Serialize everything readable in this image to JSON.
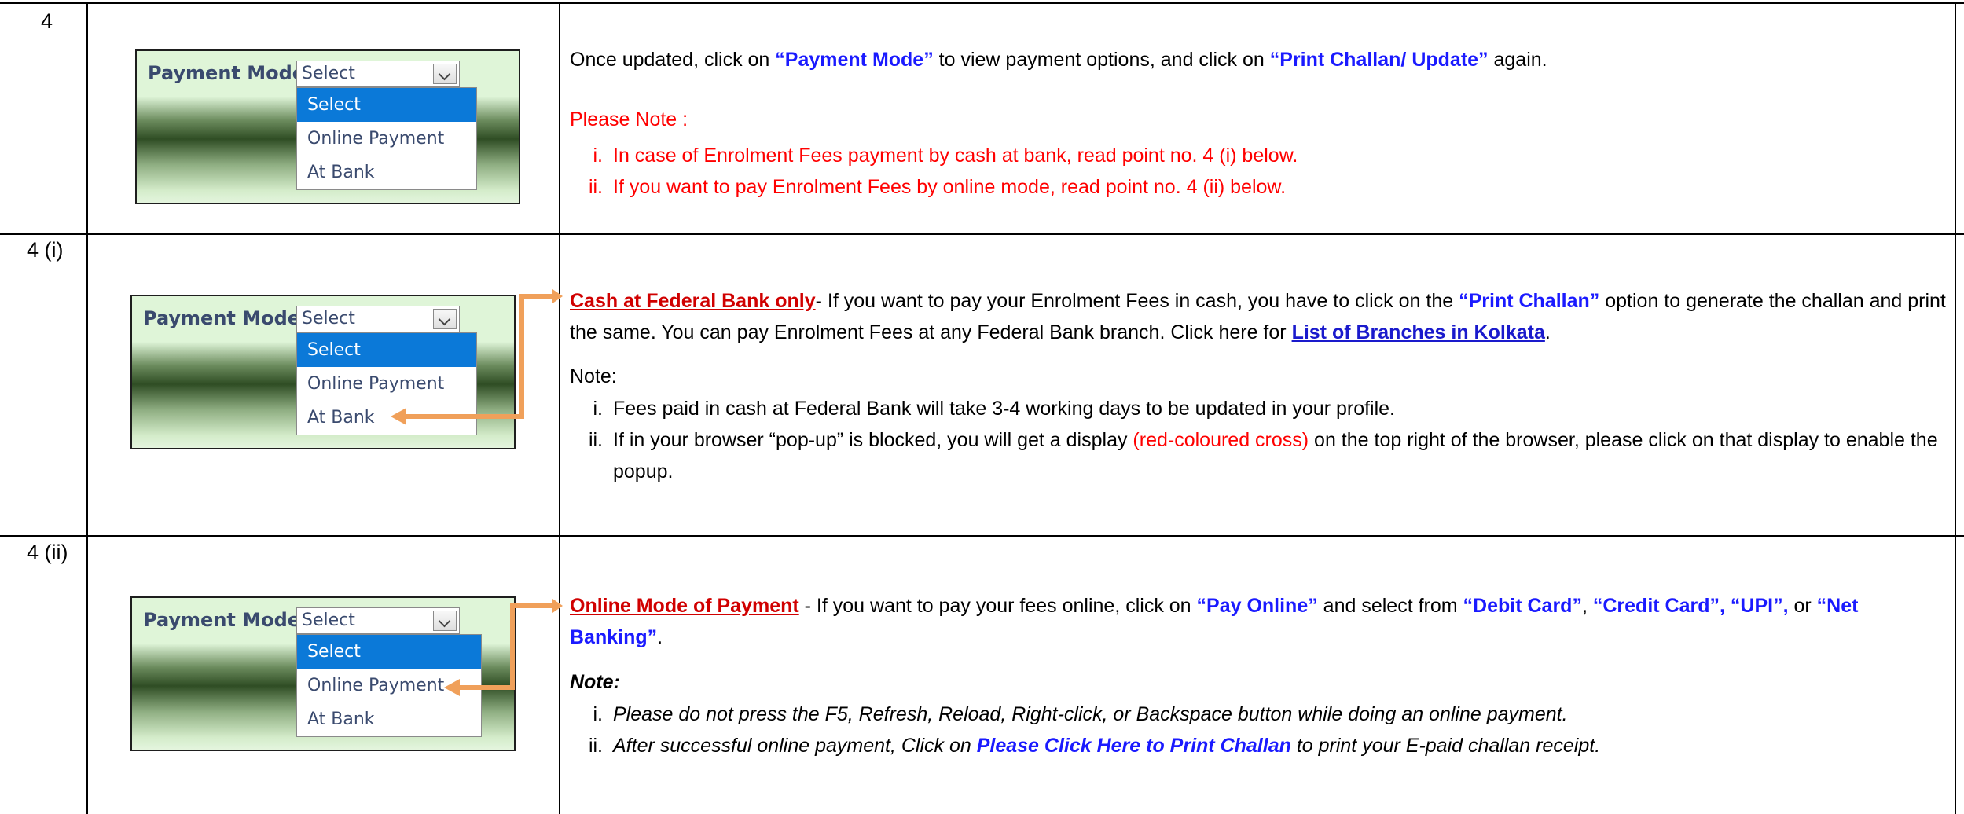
{
  "rows": [
    {
      "num": "4",
      "intro": {
        "pre": "Once updated, click on ",
        "b1": "“Payment Mode”",
        "mid": " to view payment options, and click on ",
        "b2": "“Print Challan/ Update”",
        "post": " again."
      },
      "please_note": "Please Note :",
      "notes": [
        {
          "marker": "i.",
          "text": "In case of Enrolment Fees payment by cash at bank, read point no. 4 (i) below."
        },
        {
          "marker": "ii.",
          "text": "If you want to pay Enrolment Fees by online mode, read point no. 4 (ii) below."
        }
      ]
    },
    {
      "num": "4 (i)",
      "heading": "Cash at Federal Bank only",
      "p1": "- If you want to pay your Enrolment Fees in cash, you have to click on the ",
      "p1_bold": "“Print Challan”",
      "p1_post": " option to generate the challan and print the same. You can pay Enrolment Fees at any Federal Bank branch. Click here for ",
      "link": "List of Branches in Kolkata",
      "link_post": ".",
      "note_label": "Note:",
      "notes": [
        {
          "marker": "i.",
          "text": "Fees paid in cash at Federal Bank will take 3-4 working days to be updated in your profile."
        },
        {
          "marker": "ii.",
          "pre": "If in your browser “pop-up” is blocked, you will get a display ",
          "red": "(red-coloured cross)",
          "post": " on the top right of the browser, please click on that display to enable the popup."
        }
      ]
    },
    {
      "num": "4 (ii)",
      "heading": "Online Mode of Payment",
      "p1": " - If you want to pay your fees online, click on ",
      "b_pay": "“Pay Online”",
      "p_sel": " and select from ",
      "b_debit": "“Debit Card”",
      "comma1": ", ",
      "b_credit": "“Credit Card”",
      "comma2": ", ",
      "b_upi": "“UPI”,",
      "or": " or ",
      "b_net": "“Net Banking”",
      "end": ".",
      "note_label": "Note:",
      "notes": [
        {
          "marker": "i.",
          "text": "Please do not press the F5, Refresh, Reload, Right-click, or Backspace button while doing an online payment."
        },
        {
          "marker": "ii.",
          "pre": "After successful online payment, Click on ",
          "link": "Please Click Here to Print Challan",
          "post": " to print your E-paid challan receipt."
        }
      ]
    }
  ],
  "widget": {
    "label": "Payment Mode:",
    "selected": "Select",
    "options": [
      "Select",
      "Online Payment",
      "At Bank"
    ]
  },
  "colors": {
    "accent_blue": "#1a1aff",
    "note_red": "#ff0000",
    "arrow": "#f0a05a",
    "dropdown_highlight": "#0b79d8"
  }
}
